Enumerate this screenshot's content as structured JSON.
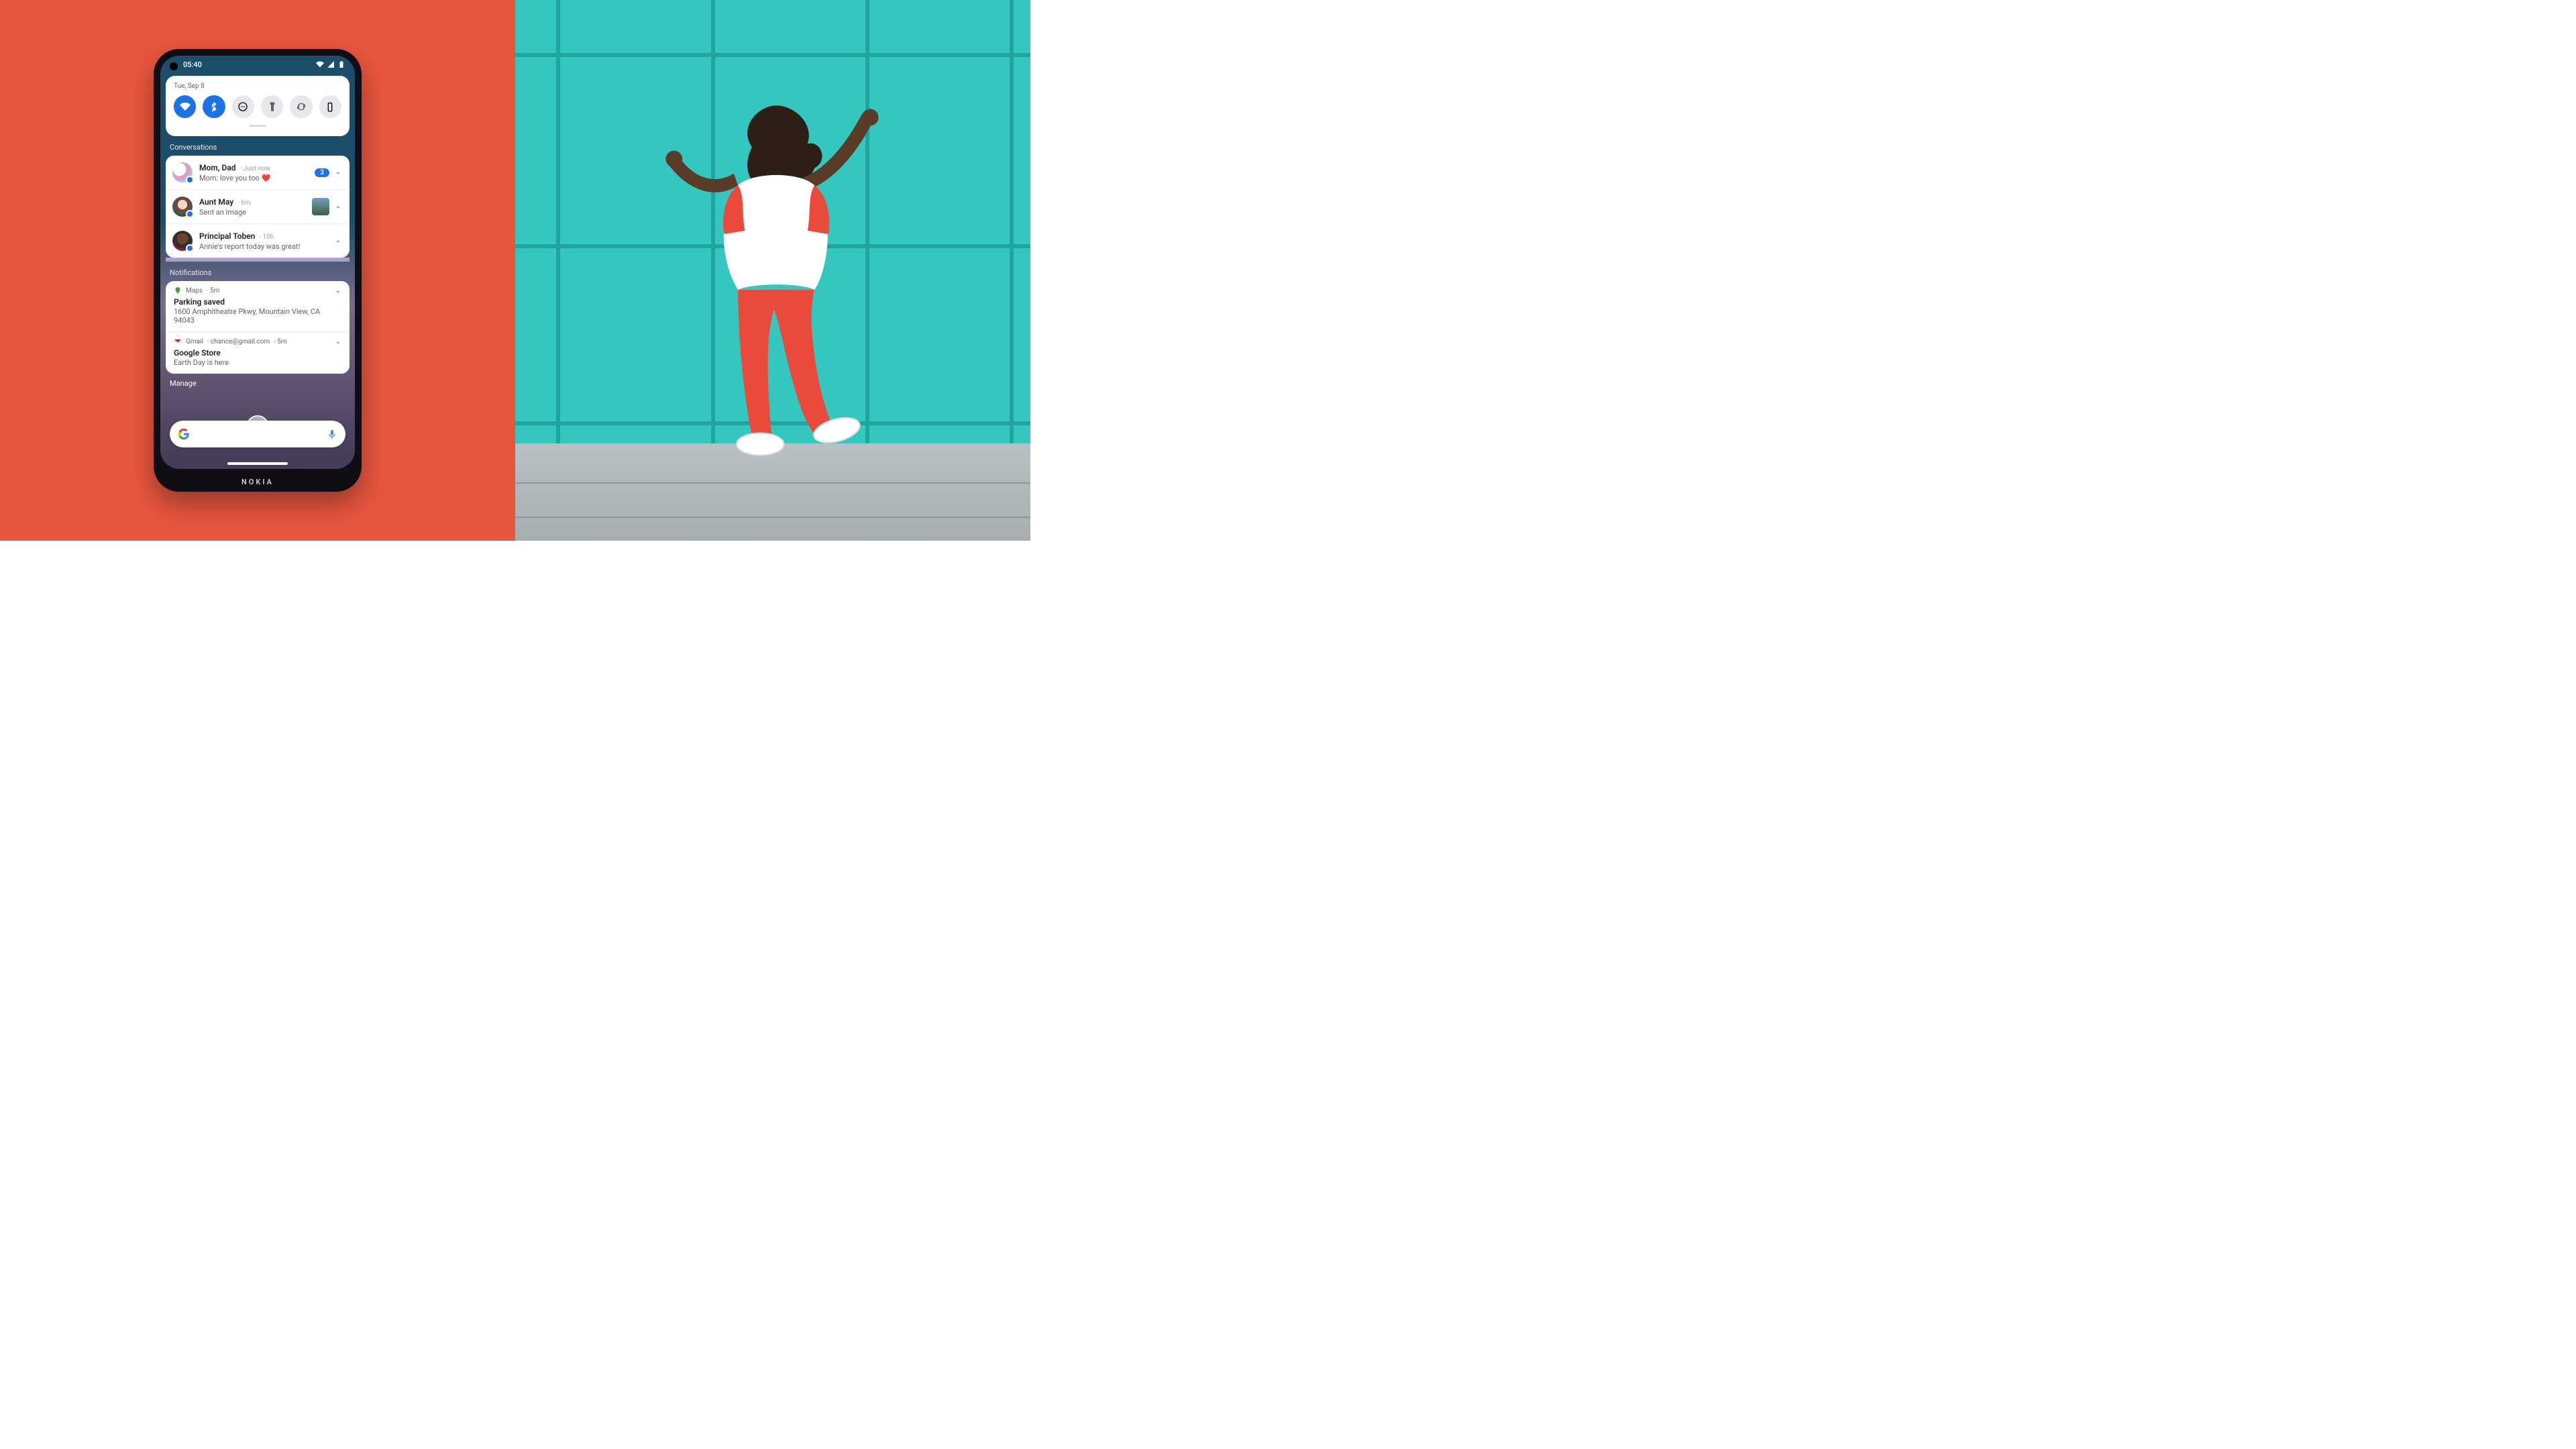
{
  "brand": "NOKIA",
  "status": {
    "time": "05:40"
  },
  "quick_settings": {
    "date": "Tue, Sep 8",
    "tiles": [
      {
        "name": "wifi",
        "on": true
      },
      {
        "name": "bluetooth",
        "on": true
      },
      {
        "name": "dnd",
        "on": false
      },
      {
        "name": "flashlight",
        "on": false
      },
      {
        "name": "autorotate",
        "on": false
      },
      {
        "name": "battery",
        "on": false
      }
    ]
  },
  "sections": {
    "conversations_label": "Conversations",
    "notifications_label": "Notifications"
  },
  "conversations": [
    {
      "title": "Mom, Dad",
      "meta": "Just now",
      "body": "Mom: love you too ❤️",
      "badge": "3"
    },
    {
      "title": "Aunt May",
      "meta": "6m",
      "body": "Sent an image",
      "thumb": true
    },
    {
      "title": "Principal Toben",
      "meta": "10h",
      "body": "Annie's report today was great!"
    }
  ],
  "notifications": [
    {
      "app": "Maps",
      "meta": "5m",
      "title": "Parking saved",
      "body": "1600 Amphitheatre Pkwy, Mountain View, CA 94043",
      "icon": "maps"
    },
    {
      "app": "Gmail",
      "account": "chance@gmail.com",
      "meta": "5m",
      "title": "Google Store",
      "body": "Earth Day is here",
      "icon": "gmail"
    }
  ],
  "manage_label": "Manage"
}
